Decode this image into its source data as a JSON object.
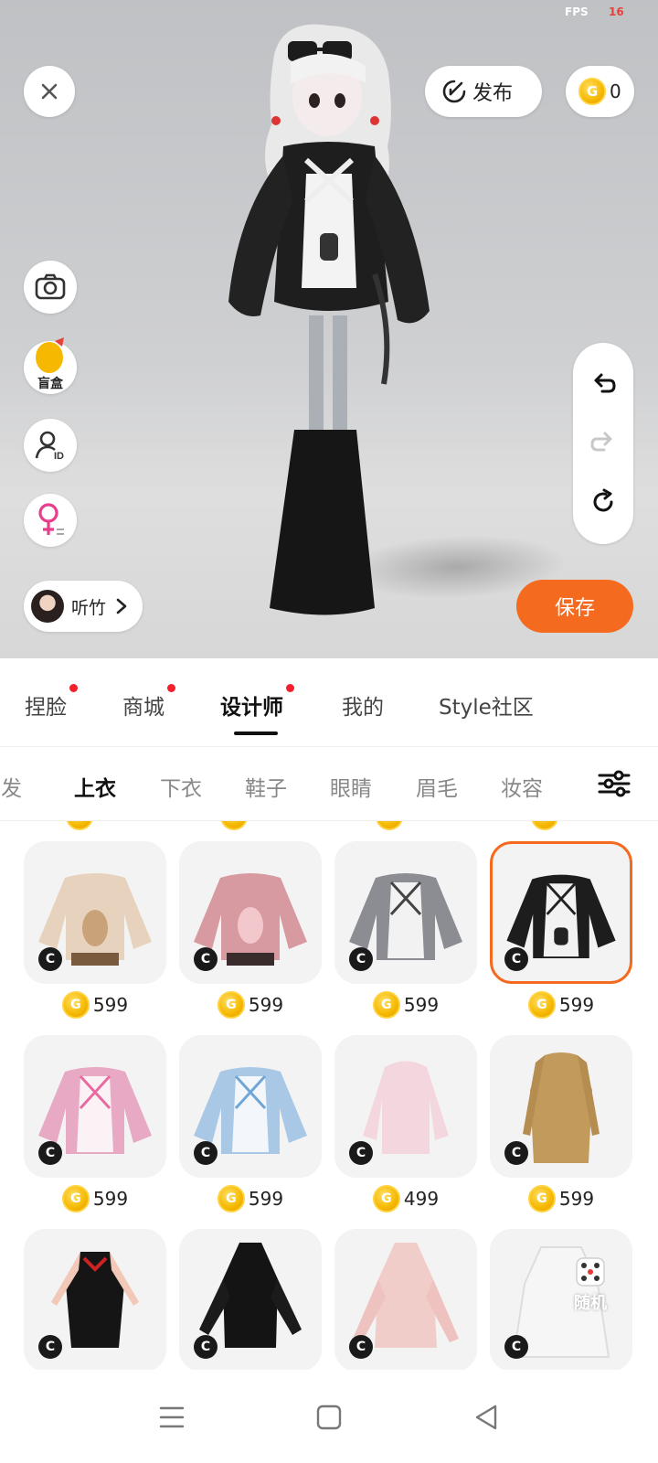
{
  "status": {
    "fps_label": "FPS",
    "fps_value": "16"
  },
  "header": {
    "publish_label": "发布",
    "coin_balance": "0"
  },
  "side_tools": {
    "blindbox_label": "盲盒"
  },
  "user": {
    "name": "听竹"
  },
  "actions": {
    "save_label": "保存"
  },
  "tabs": [
    {
      "label": "捏脸",
      "has_dot": true
    },
    {
      "label": "商城",
      "has_dot": true
    },
    {
      "label": "设计师",
      "has_dot": true,
      "active": true
    },
    {
      "label": "我的",
      "has_dot": false
    },
    {
      "label": "Style社区",
      "has_dot": false
    }
  ],
  "categories": [
    {
      "label": "头发"
    },
    {
      "label": "上衣",
      "active": true
    },
    {
      "label": "下衣"
    },
    {
      "label": "鞋子"
    },
    {
      "label": "眼睛"
    },
    {
      "label": "眉毛"
    },
    {
      "label": "妆容"
    }
  ],
  "items": [
    {
      "name": "beige bunny sweater",
      "price": "599",
      "badge": "C"
    },
    {
      "name": "pink bunny sweater",
      "price": "599",
      "badge": "C"
    },
    {
      "name": "grey maid sweater",
      "price": "599",
      "badge": "C"
    },
    {
      "name": "black maid sweater",
      "price": "599",
      "badge": "C",
      "selected": true
    },
    {
      "name": "pink maid sweater",
      "price": "599",
      "badge": "C"
    },
    {
      "name": "blue maid sweater",
      "price": "599",
      "badge": "C"
    },
    {
      "name": "pink hoodie",
      "price": "499",
      "badge": "C"
    },
    {
      "name": "camel trench coat",
      "price": "599",
      "badge": "C"
    },
    {
      "name": "black qipao dress",
      "badge": "C"
    },
    {
      "name": "black turtleneck dress",
      "badge": "C"
    },
    {
      "name": "pink knit dress",
      "badge": "C"
    },
    {
      "name": "white lace dress",
      "badge": "C"
    }
  ],
  "random": {
    "label": "随机"
  },
  "coin_glyph": "G",
  "colors": {
    "accent": "#f46a1f",
    "badge_dot": "#f21f2c",
    "coin": "#f5b800"
  }
}
